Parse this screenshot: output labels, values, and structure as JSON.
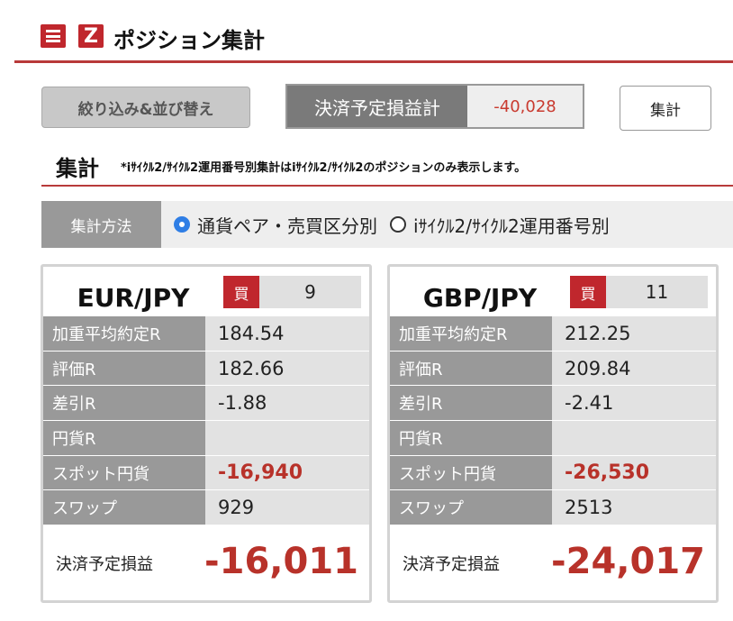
{
  "header": {
    "title": "ポジション集計",
    "menu_icon": "menu-icon",
    "logo_icon": "z-logo-icon",
    "logo_text": "Z"
  },
  "toolbar": {
    "filter_label": "絞り込み&並び替え",
    "pl_label": "決済予定損益計",
    "pl_value": "-40,028",
    "aggregate_label": "集計"
  },
  "section": {
    "title": "集計",
    "note": "*iｻｲｸﾙ2/ｻｲｸﾙ2運用番号別集計はiｻｲｸﾙ2/ｻｲｸﾙ2のポジションのみ表示します。"
  },
  "method": {
    "label": "集計方法",
    "options": [
      {
        "label": "通貨ペア・売買区分別",
        "selected": true
      },
      {
        "label": "iｻｲｸﾙ2/ｻｲｸﾙ2運用番号別",
        "selected": false
      }
    ]
  },
  "positions": [
    {
      "pair": "EUR/JPY",
      "side": "買",
      "lots": "9",
      "rows": [
        {
          "label": "加重平均約定R",
          "value": "184.54"
        },
        {
          "label": "評価R",
          "value": "182.66"
        },
        {
          "label": "差引R",
          "value": "-1.88"
        },
        {
          "label": "円貨R",
          "value": ""
        },
        {
          "label": "スポット円貨",
          "value": "-16,940"
        },
        {
          "label": "スワップ",
          "value": "929"
        }
      ],
      "total_label": "決済予定損益",
      "total_value": "-16,011"
    },
    {
      "pair": "GBP/JPY",
      "side": "買",
      "lots": "11",
      "rows": [
        {
          "label": "加重平均約定R",
          "value": "212.25"
        },
        {
          "label": "評価R",
          "value": "209.84"
        },
        {
          "label": "差引R",
          "value": "-2.41"
        },
        {
          "label": "円貨R",
          "value": ""
        },
        {
          "label": "スポット円貨",
          "value": "-26,530"
        },
        {
          "label": "スワップ",
          "value": "2513"
        }
      ],
      "total_label": "決済予定損益",
      "total_value": "-24,017"
    }
  ],
  "colors": {
    "accent": "#c0272d",
    "negative": "#b8322a",
    "radio_selected": "#2f7ee5"
  }
}
